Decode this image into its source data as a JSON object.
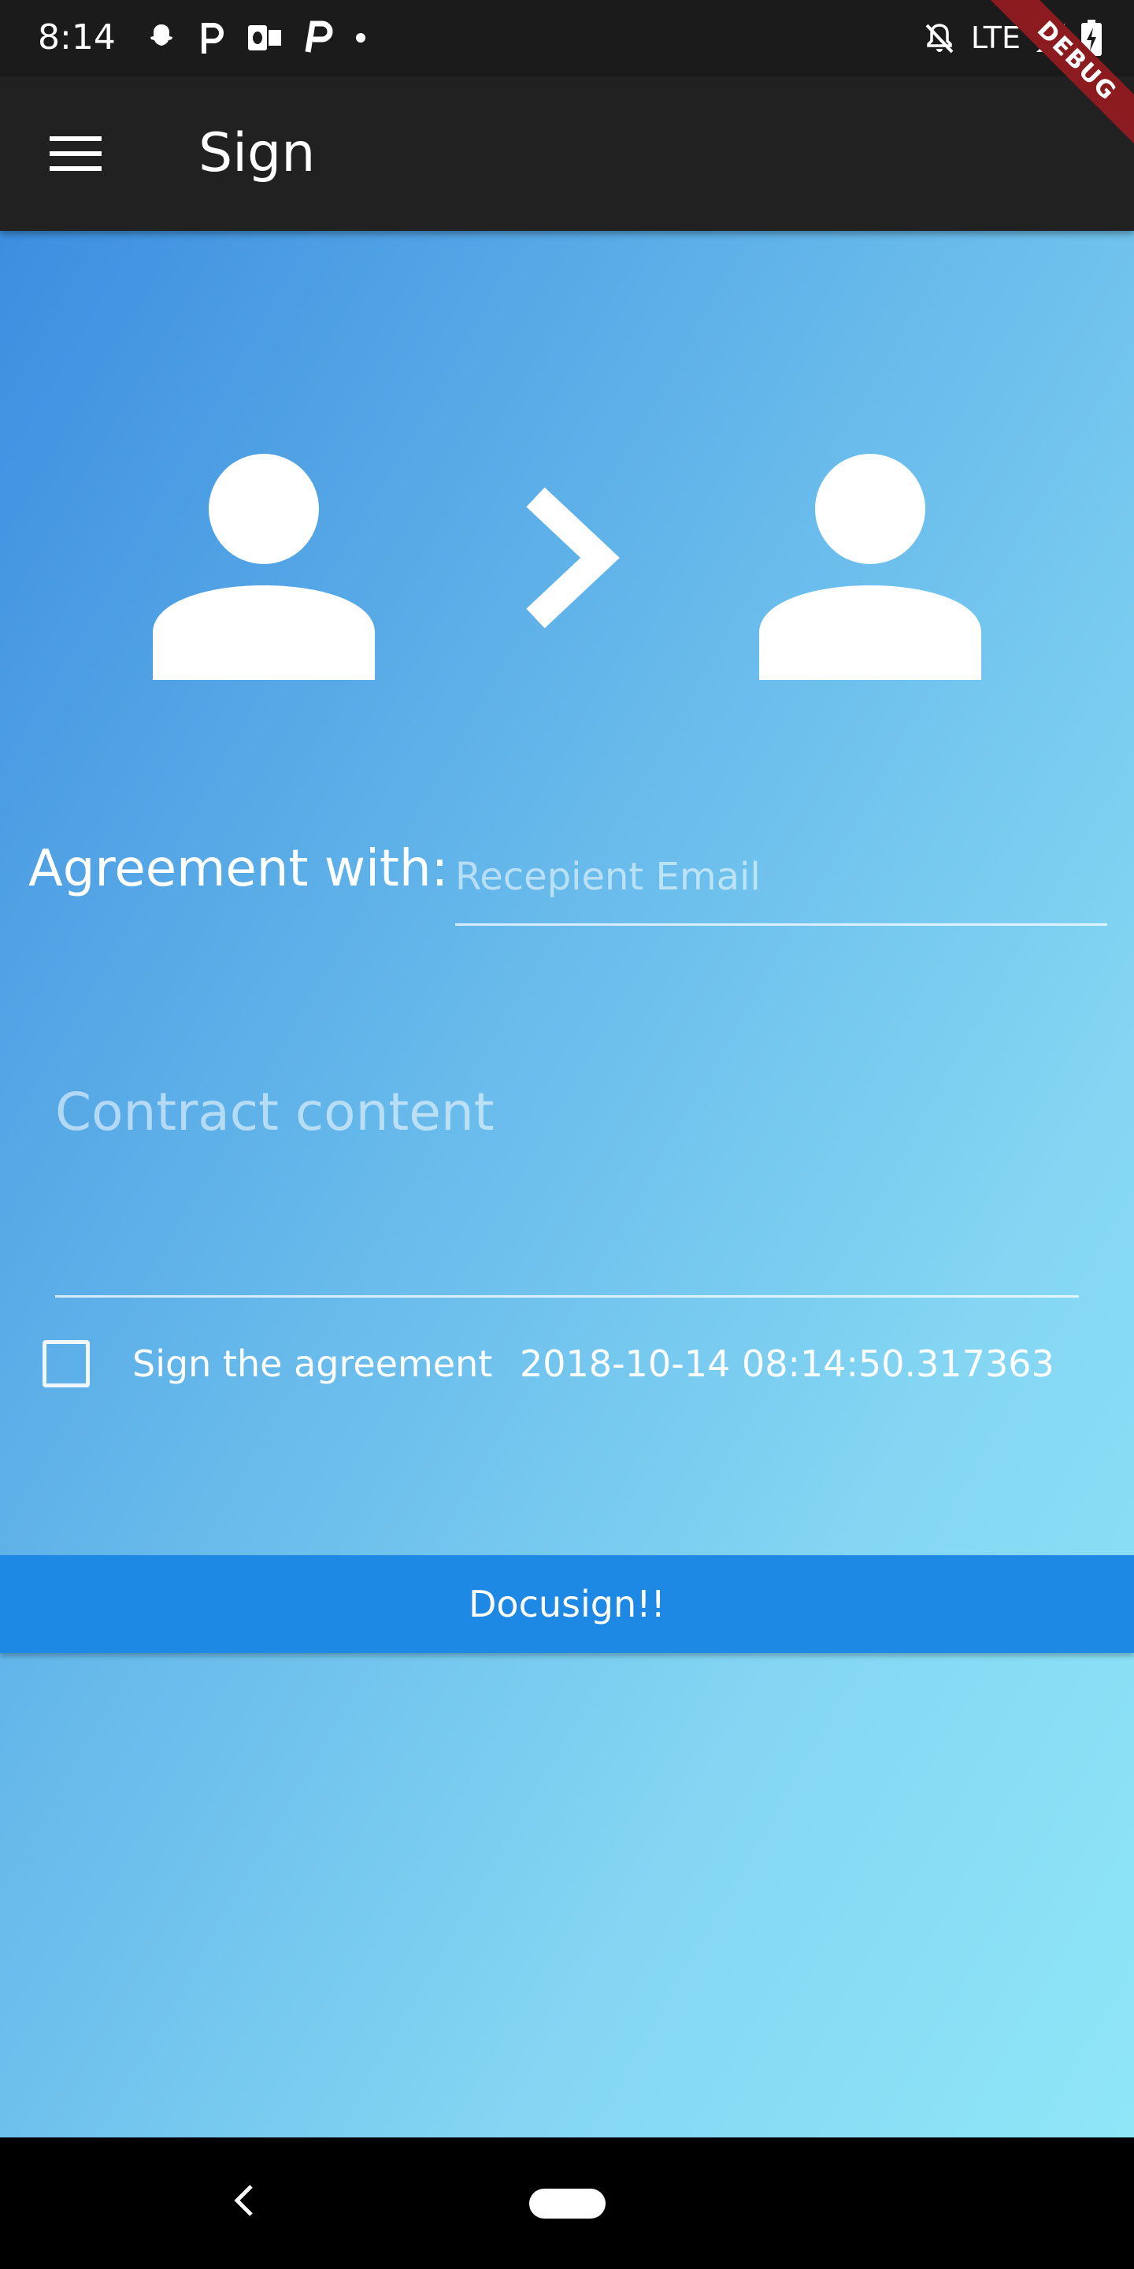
{
  "status_bar": {
    "time": "8:14",
    "network": "LTE",
    "left_icons": [
      "snapchat-icon",
      "p-app-icon",
      "outlook-icon",
      "p-app-icon",
      "dot-icon"
    ],
    "right_icons": [
      "bell-off-icon",
      "signal-icon",
      "battery-charging-icon"
    ]
  },
  "debug_banner": "DEBUG",
  "app_bar": {
    "title": "Sign",
    "menu_icon": "menu-icon"
  },
  "header_icons": {
    "left": "person-icon",
    "middle": "chevron-right-icon",
    "right": "person-icon"
  },
  "agreement": {
    "label": "Agreement with:",
    "email_placeholder": "Recepient Email",
    "email_value": ""
  },
  "contract": {
    "placeholder": "Contract content",
    "value": ""
  },
  "sign": {
    "checkbox_label": "Sign the agreement",
    "checked": false,
    "timestamp": "2018-10-14 08:14:50.317363"
  },
  "submit_button": {
    "label": "Docusign!!"
  },
  "colors": {
    "status_bar": "#1b1b1b",
    "app_bar": "#212121",
    "gradient_start": "#3d8ee0",
    "gradient_end": "#8fe6f7",
    "button": "#1e88e5",
    "debug_ribbon": "#8c1b1f"
  }
}
